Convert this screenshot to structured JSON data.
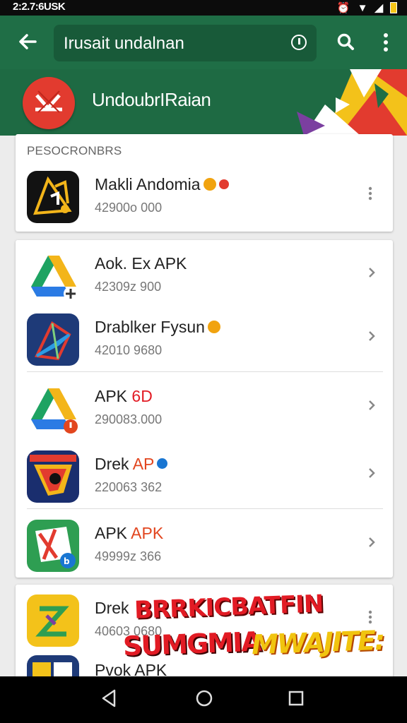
{
  "status_bar": {
    "time": "2:2.7:6USK"
  },
  "app_bar": {
    "search_text": "Irusait undalnan"
  },
  "banner": {
    "title": "UndoubrIRaian"
  },
  "section": {
    "label": "PESOCRONBRS"
  },
  "apps": [
    {
      "name": "Makli Andomia",
      "size": "42900o 000",
      "icon": "xbox-like-icon",
      "badge_color": "#f1a30f"
    },
    {
      "name": "Aok. Ex APK",
      "size": "42309z 900",
      "icon": "drive-plus-icon"
    },
    {
      "name": "Drablker Fysun",
      "size": "42010 9680",
      "icon": "polygon-app-icon",
      "badge_color": "#f1a30f"
    },
    {
      "name": "APK",
      "name_highlight": "6D",
      "size": "290083.000",
      "icon": "drive-alert-icon"
    },
    {
      "name": "Drek",
      "name_highlight": "AP",
      "size": "220063 362",
      "icon": "shield-app-icon",
      "badge_color": "#1976d2"
    },
    {
      "name": "APK",
      "name_highlight": "APK",
      "size": "49999z 366",
      "icon": "map-app-icon"
    },
    {
      "name": "Drek",
      "size": "40603 0680",
      "icon": "zip-app-icon"
    },
    {
      "name": "Pvok APK",
      "size": "",
      "icon": "blocks-app-icon"
    }
  ],
  "promo": {
    "line1": "BRRKICBATFIN",
    "line2a": "SUMGMIA",
    "line2b": "MWAJITE:"
  },
  "colors": {
    "app_bar": "#1f6e46",
    "banner": "#1e6a43",
    "accent_red": "#e23b2f"
  }
}
